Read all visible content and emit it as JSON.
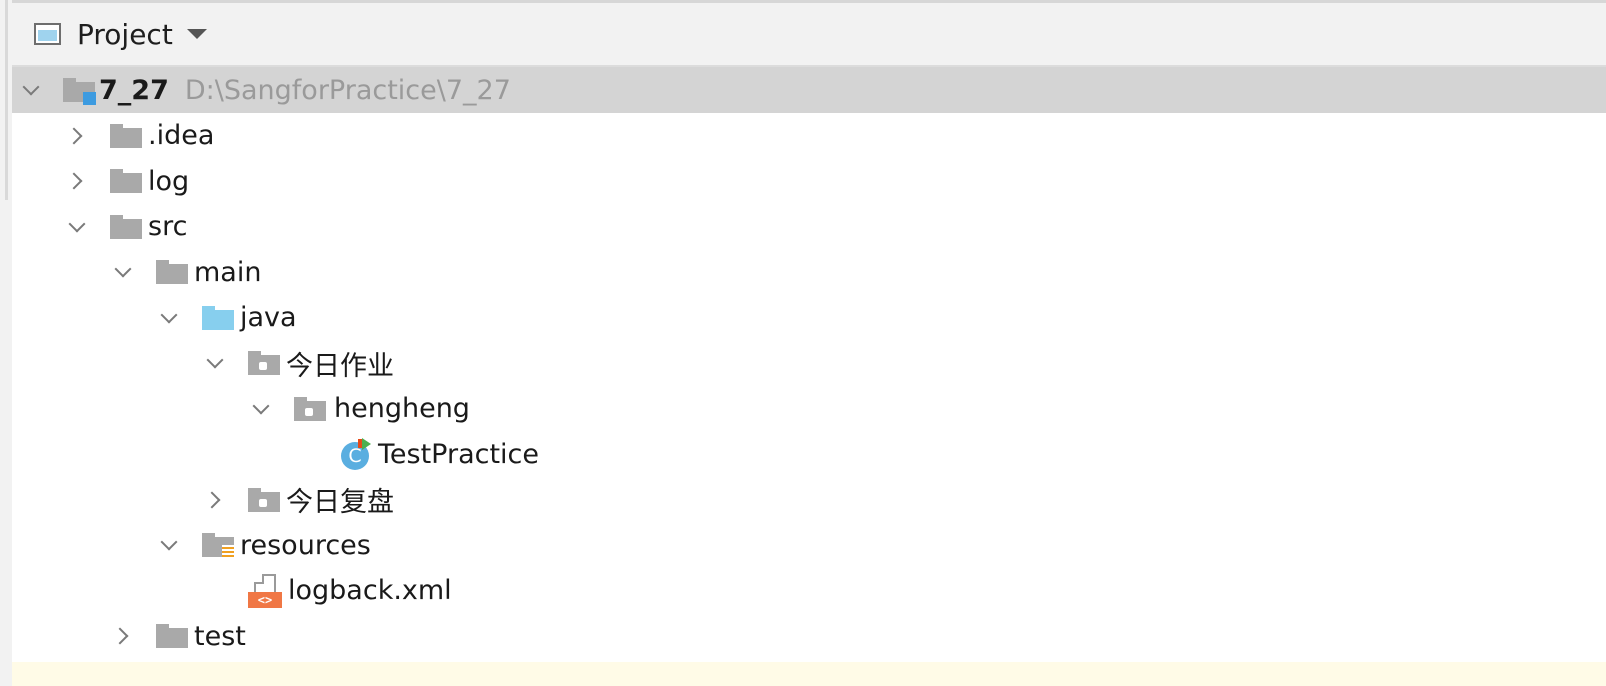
{
  "panel": {
    "title": "Project"
  },
  "tree": {
    "root_name": "7_27",
    "root_path": "D:\\SangforPractice\\7_27",
    "idea": ".idea",
    "log": "log",
    "src": "src",
    "main": "main",
    "java": "java",
    "pkg_homework": "今日作业",
    "pkg_hengheng": "hengheng",
    "class_testpractice": "TestPractice",
    "class_icon_letter": "C",
    "pkg_review": "今日复盘",
    "resources": "resources",
    "logback": "logback.xml",
    "xml_tag": "<>",
    "test": "test"
  },
  "colors": {
    "selected_row": "#d4d4d4",
    "folder_gray": "#a9a9a9",
    "source_folder_blue": "#87cfee",
    "class_icon": "#5aaee0",
    "xml_icon": "#f07745"
  },
  "icons": {
    "window": "tool-window-icon",
    "caret": "caret-down-icon",
    "folder": "folder-icon",
    "module_folder": "module-folder-icon",
    "source_folder": "source-folder-icon",
    "package": "package-icon",
    "resources_folder": "resources-folder-icon",
    "class": "java-class-icon",
    "xml": "xml-file-icon"
  }
}
